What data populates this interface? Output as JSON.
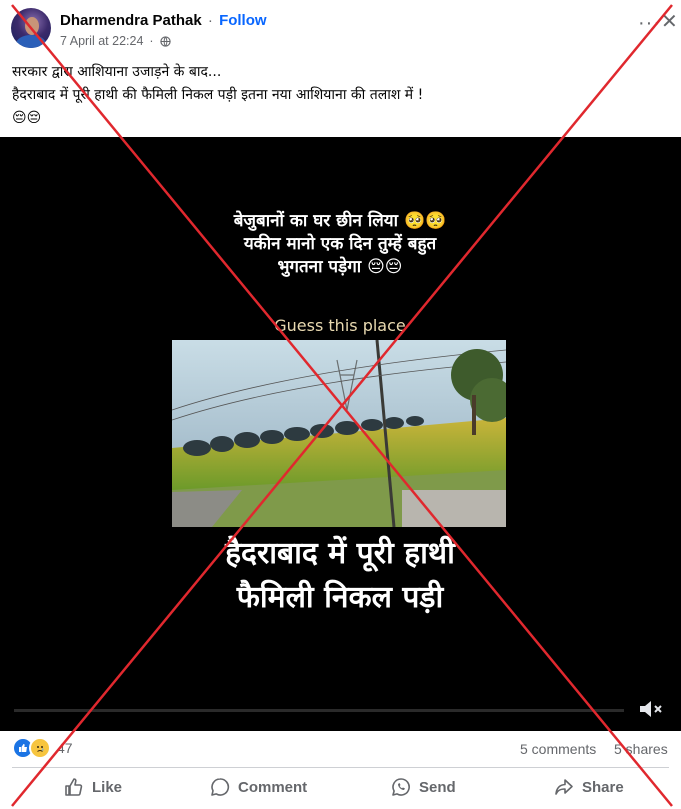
{
  "post": {
    "author": "Dharmendra Pathak",
    "separator": "·",
    "follow_label": "Follow",
    "timestamp": "7 April at 22:24",
    "audience_icon": "globe-icon",
    "more_icon": "ellipsis-icon",
    "close_icon": "close-icon",
    "text_lines": [
      "सरकार द्वारा आशियाना उजाड़ने के बाद...",
      "हैदराबाद में पूरी हाथी की फैमिली निकल पड़ी इतना नया आशियाना की तलाश में !",
      "😔😔"
    ]
  },
  "video": {
    "overlay_lines": [
      "बेजुबानों का घर छीन लिया 🥺🥺",
      "यकीन मानो एक दिन तुम्हें बहुत",
      "भुगतना पड़ेगा 😔😔"
    ],
    "caption_top": "Guess this place",
    "caption_big": [
      "हैदराबाद में पूरी हाथी",
      "फैमिली निकल पड़ी"
    ],
    "progress": 0.0,
    "volume_icon": "volume-muted-icon"
  },
  "engagement": {
    "reaction_icons": [
      "like-reaction-icon",
      "sad-reaction-icon"
    ],
    "reaction_count": "47",
    "comments": "5 comments",
    "shares": "5 shares"
  },
  "actions": {
    "like": "Like",
    "comment": "Comment",
    "send": "Send",
    "share": "Share"
  },
  "colors": {
    "accent": "#0866ff",
    "cross_mark": "#e0282e",
    "muted_text": "#65676b"
  }
}
